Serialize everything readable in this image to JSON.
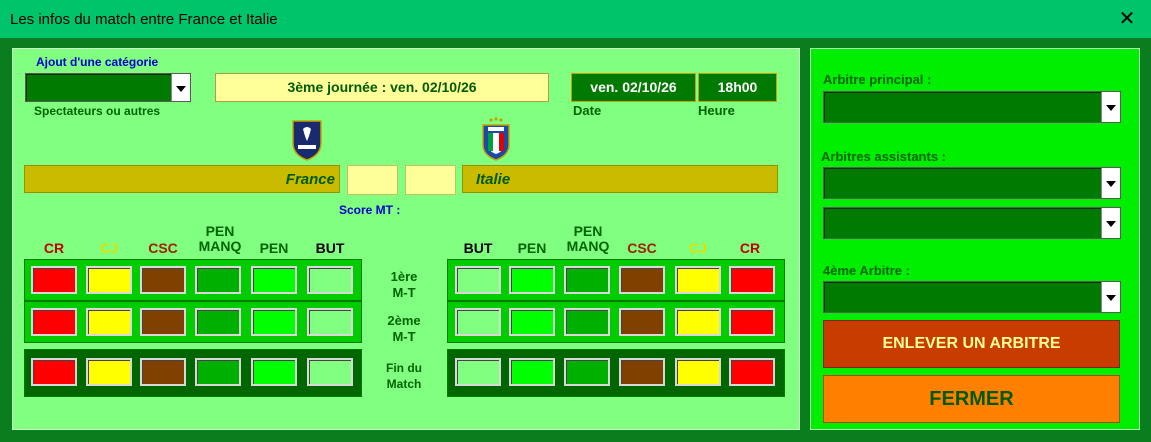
{
  "window": {
    "title": "Les infos du match entre France et Italie"
  },
  "category": {
    "title": "Ajout d'une catégorie",
    "caption": "Spectateurs ou autres"
  },
  "match": {
    "journee": "3ème journée : ven. 02/10/26",
    "date_value": "ven. 02/10/26",
    "time_value": "18h00",
    "date_label": "Date",
    "time_label": "Heure",
    "home_team": "France",
    "away_team": "Italie",
    "halftime_label": "Score MT :"
  },
  "logos": {
    "home": "FRANCE",
    "away": "ITALIA"
  },
  "columns": {
    "left": [
      "CR",
      "CJ",
      "CSC",
      "PEN MANQ",
      "PEN",
      "BUT"
    ],
    "right": [
      "BUT",
      "PEN",
      "PEN MANQ",
      "CSC",
      "CJ",
      "CR"
    ]
  },
  "periods": [
    {
      "l1": "1ère",
      "l2": "M-T"
    },
    {
      "l1": "2ème",
      "l2": "M-T"
    },
    {
      "l1": "Fin du",
      "l2": "Match"
    }
  ],
  "colors": {
    "cr": "#ff0000",
    "cj": "#ffff00",
    "csc": "#804000",
    "penmanq": "#00b000",
    "pen": "#00ff00",
    "but": "#80ff80"
  },
  "referees": {
    "main_label": "Arbitre principal :",
    "assistants_label": "Arbitres assistants :",
    "fourth_label": "4ème Arbitre :"
  },
  "buttons": {
    "remove": "ENLEVER UN ARBITRE",
    "close": "FERMER"
  }
}
